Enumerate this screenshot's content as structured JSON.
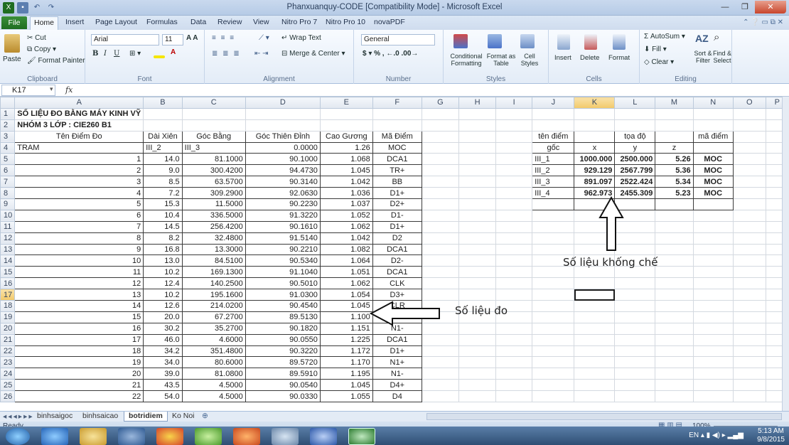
{
  "window": {
    "title": "Phanxuanquy-CODE  [Compatibility Mode]  -  Microsoft Excel"
  },
  "menu": {
    "tabs": [
      "File",
      "Home",
      "Insert",
      "Page Layout",
      "Formulas",
      "Data",
      "Review",
      "View",
      "Nitro Pro 7",
      "Nitro Pro 10",
      "novaPDF"
    ]
  },
  "ribbon": {
    "clipboard": {
      "paste": "Paste",
      "cut": "Cut",
      "copy": "Copy",
      "format_painter": "Format Painter",
      "label": "Clipboard"
    },
    "font": {
      "name": "Arial",
      "size": "11",
      "label": "Font"
    },
    "alignment": {
      "wrap": "Wrap Text",
      "merge": "Merge & Center",
      "label": "Alignment"
    },
    "number": {
      "format": "General",
      "label": "Number"
    },
    "styles": {
      "conditional": "Conditional Formatting",
      "format_table": "Format as Table",
      "cell_styles": "Cell Styles",
      "label": "Styles"
    },
    "cells": {
      "insert": "Insert",
      "delete": "Delete",
      "format": "Format",
      "label": "Cells"
    },
    "editing": {
      "autosum": "AutoSum",
      "fill": "Fill",
      "clear": "Clear",
      "sort": "Sort & Filter",
      "find": "Find & Select",
      "label": "Editing"
    }
  },
  "formula_bar": {
    "cell_ref": "K17",
    "fx": "fx",
    "value": ""
  },
  "columns": [
    "A",
    "B",
    "C",
    "D",
    "E",
    "F",
    "G",
    "H",
    "I",
    "J",
    "K",
    "L",
    "M",
    "N",
    "O",
    "P"
  ],
  "selected": {
    "column": "K",
    "row": 17
  },
  "sheet": {
    "title1": "SỐ LIỆU ĐO BẰNG MÁY KINH VỸ",
    "title2": "NHÓM 3 LỚP : CIE260 B1",
    "headers": [
      "Tên Điểm Đo",
      "Dài Xiên",
      "Góc Bằng",
      "Góc Thiên Đỉnh",
      "Cao Gương",
      "Mã Điểm"
    ],
    "station": [
      "TRAM",
      "III_2",
      "III_3",
      "0.0000",
      "1.26",
      "MOC"
    ],
    "rows": [
      [
        "1",
        "14.0",
        "81.1000",
        "90.1000",
        "1.068",
        "DCA1"
      ],
      [
        "2",
        "9.0",
        "300.4200",
        "94.4730",
        "1.045",
        "TR+"
      ],
      [
        "3",
        "8.5",
        "63.5700",
        "90.3140",
        "1.042",
        "BB"
      ],
      [
        "4",
        "7.2",
        "309.2900",
        "92.0630",
        "1.036",
        "D1+"
      ],
      [
        "5",
        "15.3",
        "11.5000",
        "90.2230",
        "1.037",
        "D2+"
      ],
      [
        "6",
        "10.4",
        "336.5000",
        "91.3220",
        "1.052",
        "D1-"
      ],
      [
        "7",
        "14.5",
        "256.4200",
        "90.1610",
        "1.062",
        "D1+"
      ],
      [
        "8",
        "8.2",
        "32.4800",
        "91.5140",
        "1.042",
        "D2"
      ],
      [
        "9",
        "16.8",
        "13.3000",
        "90.2210",
        "1.082",
        "DCA1"
      ],
      [
        "10",
        "13.0",
        "84.5100",
        "90.5340",
        "1.064",
        "D2-"
      ],
      [
        "11",
        "10.2",
        "169.1300",
        "91.1040",
        "1.051",
        "DCA1"
      ],
      [
        "12",
        "12.4",
        "140.2500",
        "90.5010",
        "1.062",
        "CLK"
      ],
      [
        "13",
        "10.2",
        "195.1600",
        "91.0300",
        "1.054",
        "D3+"
      ],
      [
        "14",
        "12.6",
        "214.0200",
        "90.4540",
        "1.045",
        "CLR"
      ],
      [
        "15",
        "20.0",
        "67.2700",
        "89.5130",
        "1.100",
        "N1+"
      ],
      [
        "16",
        "30.2",
        "35.2700",
        "90.1820",
        "1.151",
        "N1-"
      ],
      [
        "17",
        "46.0",
        "4.6000",
        "90.0550",
        "1.225",
        "DCA1"
      ],
      [
        "18",
        "34.2",
        "351.4800",
        "90.3220",
        "1.172",
        "D1+"
      ],
      [
        "19",
        "34.0",
        "80.6000",
        "89.5720",
        "1.170",
        "N1+"
      ],
      [
        "20",
        "39.0",
        "81.0800",
        "89.5910",
        "1.195",
        "N1-"
      ],
      [
        "21",
        "43.5",
        "4.5000",
        "90.0540",
        "1.045",
        "D4+"
      ],
      [
        "22",
        "54.0",
        "4.5000",
        "90.0330",
        "1.055",
        "D4"
      ]
    ],
    "control": {
      "h_name1": "tên điểm",
      "h_name2": "gốc",
      "h_coord": "tọa độ",
      "h_code": "mã điểm",
      "h_x": "x",
      "h_y": "y",
      "h_z": "z",
      "rows": [
        [
          "III_1",
          "1000.000",
          "2500.000",
          "5.26",
          "MOC"
        ],
        [
          "III_2",
          "929.129",
          "2567.799",
          "5.36",
          "MOC"
        ],
        [
          "III_3",
          "891.097",
          "2522.424",
          "5.34",
          "MOC"
        ],
        [
          "III_4",
          "962.973",
          "2455.309",
          "5.23",
          "MOC"
        ]
      ]
    }
  },
  "annotations": {
    "control_label": "Số liệu khống chế",
    "measure_label": "Số liệu đo"
  },
  "sheet_tabs": [
    "binhsaigoc",
    "binhsaicao",
    "botridiem",
    "Ko Noi"
  ],
  "active_sheet": "botridiem",
  "status": {
    "ready": "Ready",
    "zoom": "100%"
  },
  "taskbar": {
    "lang": "EN",
    "time": "5:13 AM",
    "date": "9/8/2015"
  }
}
